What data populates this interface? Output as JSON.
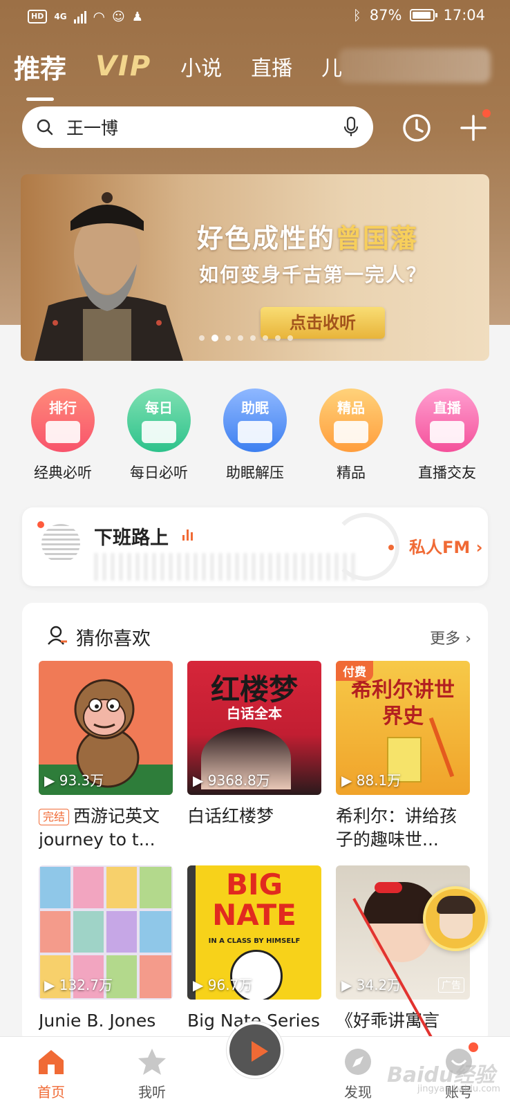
{
  "status": {
    "battery": "87%",
    "time": "17:04",
    "network": "4G",
    "hd": "HD"
  },
  "tabs": [
    {
      "label": "推荐",
      "active": true
    },
    {
      "label": "VIP",
      "active": false
    },
    {
      "label": "小说",
      "active": false
    },
    {
      "label": "直播",
      "active": false
    },
    {
      "label": "儿",
      "active": false
    }
  ],
  "search": {
    "query": "王一博"
  },
  "banner": {
    "line1_prefix": "好色成性的",
    "line1_highlight": "曾国藩",
    "line2": "如何变身千古第一完人？",
    "cta": "点击收听",
    "page_count": 8,
    "active_page": 1
  },
  "quick_icons": [
    {
      "circle_label": "排行",
      "label": "经典必听",
      "color_a": "#ff8a7a",
      "color_b": "#f8536b"
    },
    {
      "circle_label": "每日",
      "label": "每日必听",
      "color_a": "#7fe0b2",
      "color_b": "#2dc28b"
    },
    {
      "circle_label": "助眠",
      "label": "助眠解压",
      "color_a": "#8fb8ff",
      "color_b": "#3d7ff0"
    },
    {
      "circle_label": "精品",
      "label": "精品",
      "color_a": "#ffd27a",
      "color_b": "#ff9d3c"
    },
    {
      "circle_label": "直播",
      "label": "直播交友",
      "color_a": "#ff9fd0",
      "color_b": "#f4509a"
    }
  ],
  "fm": {
    "title": "下班路上",
    "link": "私人FM"
  },
  "recommend": {
    "title": "猜你喜欢",
    "more": "更多",
    "items": [
      {
        "plays": "93.3万",
        "badge": "完结",
        "name": "西游记英文journey to t...",
        "cover_text": "",
        "tag": "",
        "ad": ""
      },
      {
        "plays": "9368.8万",
        "badge": "",
        "name": "白话红楼梦",
        "cover_text": "红楼梦",
        "cover_sub": "白话全本",
        "tag": "",
        "ad": ""
      },
      {
        "plays": "88.1万",
        "badge": "",
        "name": "希利尔：讲给孩子的趣味世...",
        "cover_text": "希利尔讲世界史",
        "tag": "付费",
        "ad": ""
      },
      {
        "plays": "132.7万",
        "badge": "",
        "name": "Junie B. Jones",
        "cover_text": "",
        "tag": "",
        "ad": ""
      },
      {
        "plays": "96.7万",
        "badge": "",
        "name": "Big Nate Series",
        "cover_text": "BIG NATE",
        "cover_sub": "IN A CLASS BY HIMSELF",
        "tag": "",
        "ad": ""
      },
      {
        "plays": "34.2万",
        "badge": "",
        "name": "《好乖讲寓言",
        "cover_text": "",
        "tag": "",
        "ad": "广告"
      }
    ]
  },
  "nav": [
    {
      "label": "首页",
      "icon": "home-icon",
      "active": true
    },
    {
      "label": "我听",
      "icon": "star-icon",
      "active": false
    },
    {
      "label": "发现",
      "icon": "compass-icon",
      "active": false
    },
    {
      "label": "账号",
      "icon": "account-icon",
      "active": false
    }
  ],
  "watermark": {
    "brand": "Baidu经验",
    "url": "jingyan.baidu.com"
  },
  "colors": {
    "accent": "#f06a35",
    "header": "#a57a50",
    "gold": "#f7cf5c"
  }
}
